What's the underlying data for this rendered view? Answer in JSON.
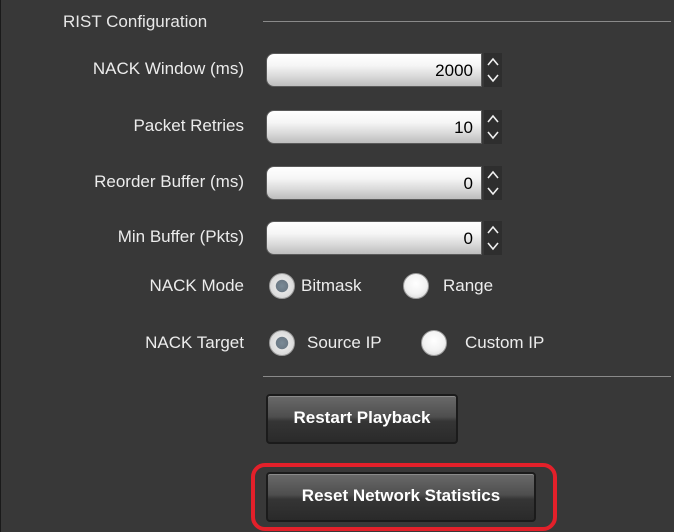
{
  "group": {
    "title": "RIST Configuration"
  },
  "fields": [
    {
      "label": "NACK Window (ms)",
      "value": "2000"
    },
    {
      "label": "Packet Retries",
      "value": "10"
    },
    {
      "label": "Reorder Buffer (ms)",
      "value": "0"
    },
    {
      "label": "Min Buffer (Pkts)",
      "value": "0"
    }
  ],
  "nack_mode": {
    "label": "NACK Mode",
    "options": [
      {
        "label": "Bitmask",
        "selected": true
      },
      {
        "label": "Range",
        "selected": false
      }
    ]
  },
  "nack_target": {
    "label": "NACK Target",
    "options": [
      {
        "label": "Source IP",
        "selected": true
      },
      {
        "label": "Custom IP",
        "selected": false
      }
    ]
  },
  "buttons": {
    "restart_playback": "Restart Playback",
    "reset_network_statistics": "Reset Network Statistics"
  },
  "colors": {
    "panel_background": "#383838",
    "highlight": "#e3202a"
  }
}
